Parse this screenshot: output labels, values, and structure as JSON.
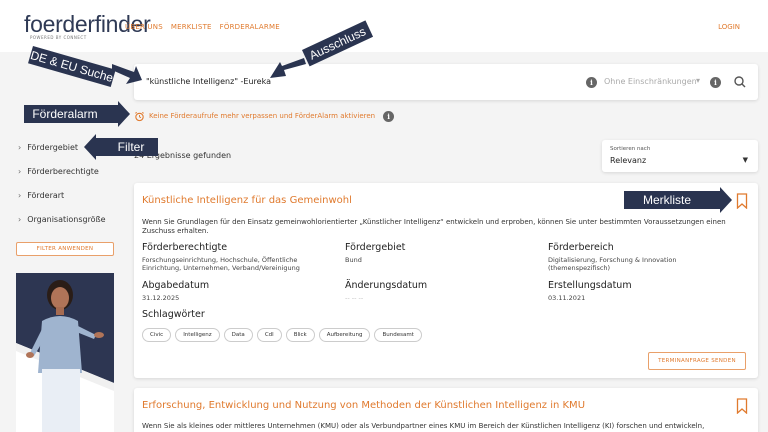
{
  "header": {
    "logo": "foerderfinder",
    "logo_sub": "POWERED BY CONNECT",
    "nav": [
      "ÜBER UNS",
      "MERKLISTE",
      "FÖRDERALARME"
    ],
    "login": "LOGIN"
  },
  "search": {
    "query": "\"künstliche Intelligenz\" -Eureka",
    "restriction": "Ohne Einschränkungen"
  },
  "alarm": {
    "link": "Keine Förderaufrufe mehr verpassen und FörderAlarm aktivieren"
  },
  "sidebar": {
    "filters": [
      "Fördergebiet",
      "Förderberechtigte",
      "Förderart",
      "Organisationsgröße"
    ],
    "apply_label": "FILTER ANWENDEN"
  },
  "results": {
    "count_text": "24 Ergebnisse gefunden",
    "sort_label": "Sortieren nach",
    "sort_value": "Relevanz"
  },
  "card1": {
    "title": "Künstliche Intelligenz für das Gemeinwohl",
    "description": "Wenn Sie Grundlagen für den Einsatz gemeinwohlorientierter „Künstlicher Intelligenz“ entwickeln und erproben, können Sie unter bestimmten Voraussetzungen einen Zuschuss erhalten.",
    "berechtigte_head": "Förderberechtigte",
    "berechtigte_val": "Forschungseinrichtung, Hochschule, Öffentliche Einrichtung, Unternehmen, Verband/Vereinigung",
    "gebiet_head": "Fördergebiet",
    "gebiet_val": "Bund",
    "bereich_head": "Förderbereich",
    "bereich_val": "Digitalisierung, Forschung & Innovation (themenspezifisch)",
    "abgabe_head": "Abgabedatum",
    "abgabe_val": "31.12.2025",
    "aenderung_head": "Änderungsdatum",
    "aenderung_val": "-- -- --",
    "erstellung_head": "Erstellungsdatum",
    "erstellung_val": "03.11.2021",
    "tags_head": "Schlagwörter",
    "tags": [
      "Civic",
      "Intelligenz",
      "Data",
      "Cdl",
      "Blick",
      "Aufbereitung",
      "Bundesamt"
    ],
    "termin_label": "TERMINANFRAGE SENDEN"
  },
  "card2": {
    "title": "Erforschung, Entwicklung und Nutzung von Methoden der Künstlichen Intelligenz in KMU",
    "description": "Wenn Sie als kleines oder mittleres Unternehmen (KMU) oder als Verbundpartner eines KMU im Bereich der Künstlichen Intelligenz (KI) forschen und entwickeln,"
  },
  "callouts": {
    "de_eu": "DE & EU Suche",
    "ausschluss": "Ausschluss",
    "foerderalarm": "Förderalarm",
    "filter": "Filter",
    "merkliste": "Merkliste"
  },
  "colors": {
    "accent": "#e07a2e",
    "navy": "#2a3450",
    "background": "#f4f4f4"
  }
}
